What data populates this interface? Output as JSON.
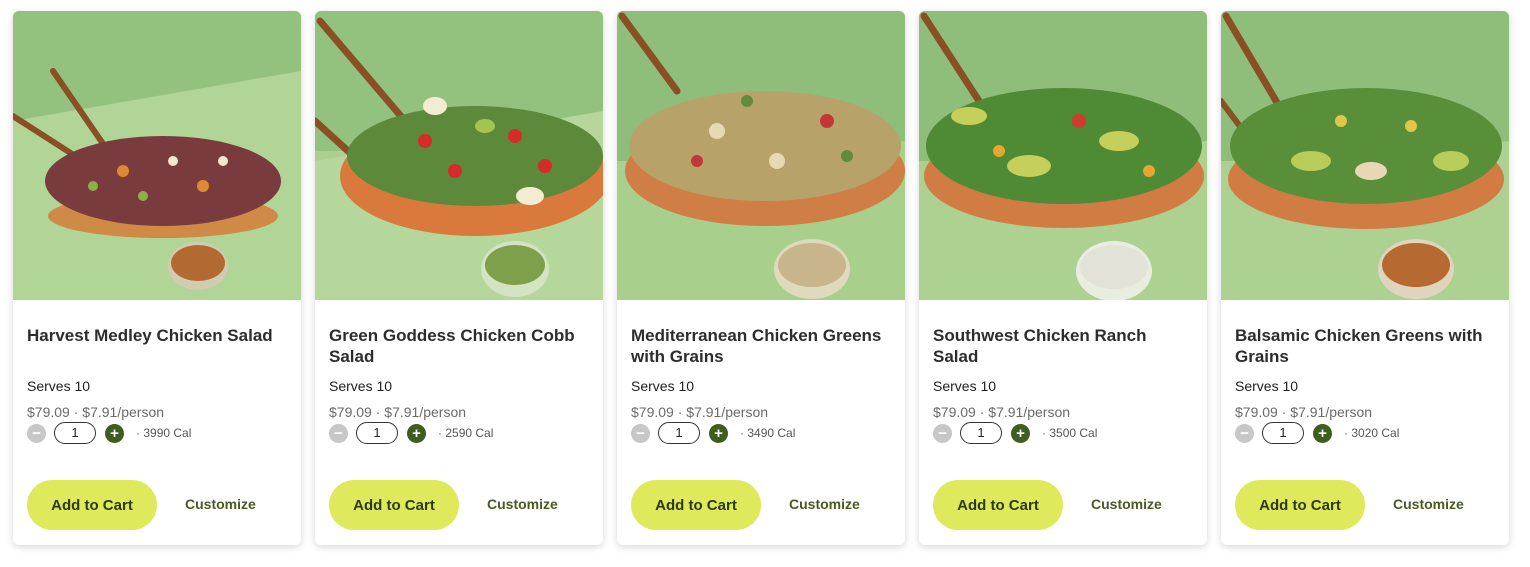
{
  "products": [
    {
      "name": "Harvest Medley Chicken Salad",
      "serves": "Serves 10",
      "price": "$79.09",
      "per_person": "$7.91/person",
      "quantity": "1",
      "calories": "3990 Cal",
      "add_label": "Add to Cart",
      "customize_label": "Customize"
    },
    {
      "name": "Green Goddess Chicken Cobb Salad",
      "serves": "Serves 10",
      "price": "$79.09",
      "per_person": "$7.91/person",
      "quantity": "1",
      "calories": "2590 Cal",
      "add_label": "Add to Cart",
      "customize_label": "Customize"
    },
    {
      "name": "Mediterranean Chicken Greens with Grains",
      "serves": "Serves 10",
      "price": "$79.09",
      "per_person": "$7.91/person",
      "quantity": "1",
      "calories": "3490 Cal",
      "add_label": "Add to Cart",
      "customize_label": "Customize"
    },
    {
      "name": "Southwest Chicken Ranch Salad",
      "serves": "Serves 10",
      "price": "$79.09",
      "per_person": "$7.91/person",
      "quantity": "1",
      "calories": "3500 Cal",
      "add_label": "Add to Cart",
      "customize_label": "Customize"
    },
    {
      "name": "Balsamic Chicken Greens with Grains",
      "serves": "Serves 10",
      "price": "$79.09",
      "per_person": "$7.91/person",
      "quantity": "1",
      "calories": "3020 Cal",
      "add_label": "Add to Cart",
      "customize_label": "Customize"
    }
  ],
  "separator": "·",
  "icons": {
    "decrease": "minus-icon",
    "increase": "plus-icon"
  },
  "colors": {
    "accent_button": "#dfe95c",
    "plus_button": "#3f5d1e",
    "minus_button": "#c7c7c7",
    "photo_background": "#8fbf7c"
  }
}
